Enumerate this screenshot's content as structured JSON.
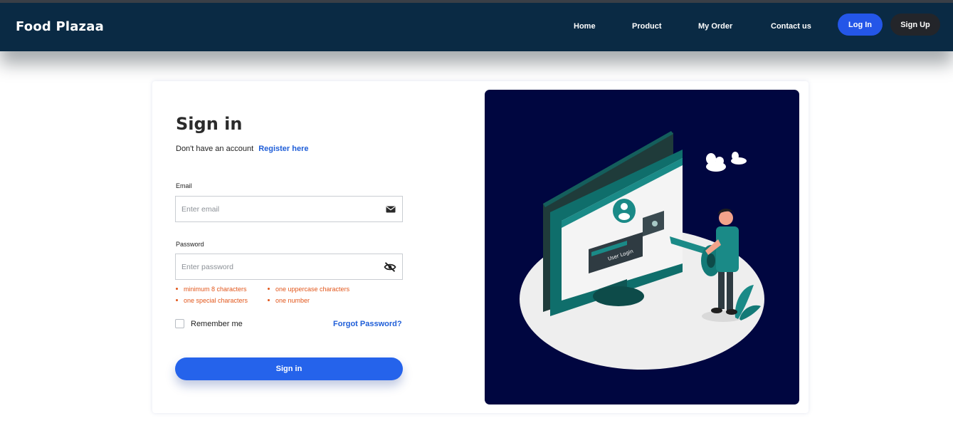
{
  "navbar": {
    "brand": "Food Plazaa",
    "links": [
      "Home",
      "Product",
      "My Order",
      "Contact us"
    ],
    "login_label": "Log In",
    "signup_label": "Sign Up"
  },
  "form": {
    "title": "Sign in",
    "register_prompt": "Don't have an account",
    "register_link": "Register here",
    "email_label": "Email",
    "email_placeholder": "Enter email",
    "password_label": "Password",
    "password_placeholder": "Enter password",
    "password_rules": [
      "minimum 8 characters",
      "one uppercase characters",
      "one special characters",
      "one number"
    ],
    "remember_label": "Remember me",
    "forgot_label": "Forgot Password?",
    "submit_label": "Sign in"
  },
  "illustration": {
    "screen_caption": "User Login"
  },
  "colors": {
    "navbar": "#0a2a44",
    "accent": "#2563eb",
    "link": "#1f5ed8",
    "rule_text": "#e2571c",
    "illustration_bg": "#000640",
    "teal": "#1a8a87"
  }
}
